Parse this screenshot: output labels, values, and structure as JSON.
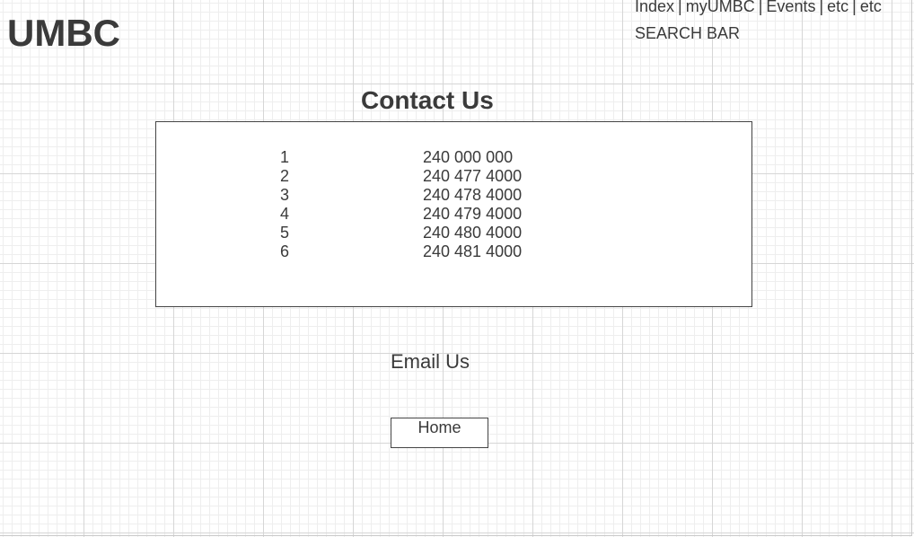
{
  "header": {
    "logo": "UMBC",
    "nav": {
      "items": [
        "Index",
        "myUMBC",
        "Events",
        "etc",
        "etc"
      ],
      "separator": "|"
    },
    "search_bar": "SEARCH BAR"
  },
  "main": {
    "title": "Contact Us",
    "contacts": [
      {
        "number": "1",
        "phone": "240 000 000"
      },
      {
        "number": "2",
        "phone": "240 477 4000"
      },
      {
        "number": "3",
        "phone": "240 478 4000"
      },
      {
        "number": "4",
        "phone": "240 479 4000"
      },
      {
        "number": "5",
        "phone": "240 480 4000"
      },
      {
        "number": "6",
        "phone": "240 481 4000"
      }
    ],
    "email_link": "Email Us",
    "home_button": "Home"
  },
  "colors": {
    "text": "#3a3a3a",
    "border": "#444444",
    "grid_major": "#d6d6d6",
    "grid_minor": "#eeeeee"
  }
}
